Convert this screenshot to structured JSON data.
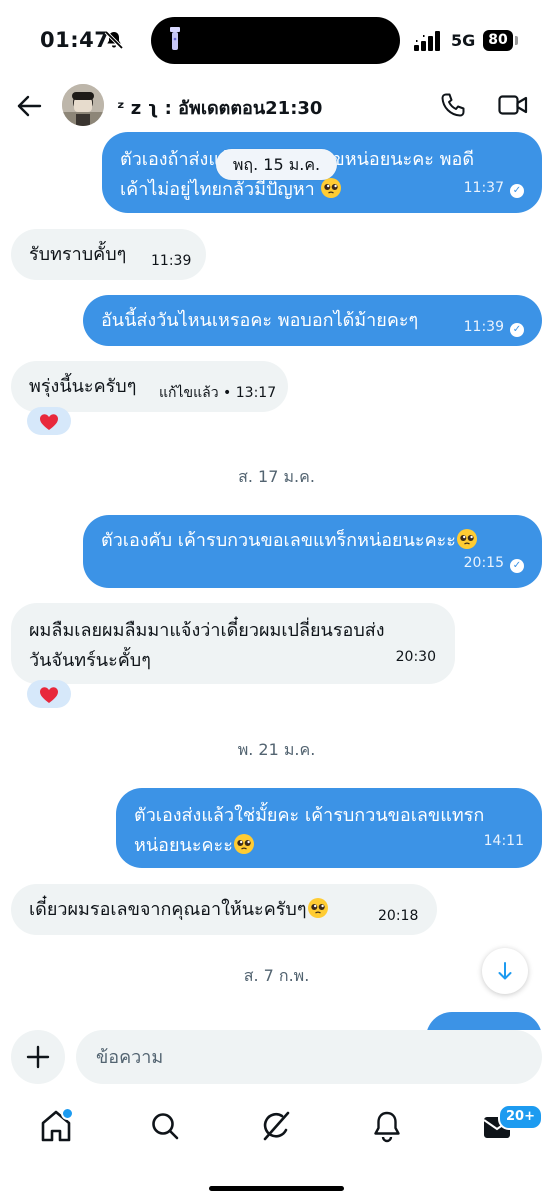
{
  "status_bar": {
    "time": "01:47",
    "network": "5G",
    "battery": "80"
  },
  "header": {
    "title": "ᶻ z ʅ : อัพเดตตอน21:30"
  },
  "floating_date": "พฤ. 15 ม.ค.",
  "messages": [
    {
      "id": "m1",
      "dir": "out",
      "lines": [
        "ตัวเองถ้าส่งแล้วรบกวนส่งเลขหน่อยนะคะ พอดี",
        "เค้าไม่อยู่ไทยกลัวมีปัญหา"
      ],
      "time": "11:37",
      "status": "read"
    },
    {
      "id": "m2",
      "dir": "in",
      "lines": [
        "รับทราบคั้บๆ"
      ],
      "time": "11:39"
    },
    {
      "id": "m3",
      "dir": "out",
      "lines": [
        "อันนี้ส่งวันไหนเหรอคะ พอบอกได้ม้ายคะๆ"
      ],
      "time": "11:39",
      "status": "read"
    },
    {
      "id": "m4",
      "dir": "in",
      "lines": [
        "พรุ่งนี้นะครับๆ"
      ],
      "edited": "แก้ไขแล้ว",
      "time": "13:17",
      "reaction": "heart"
    },
    {
      "id": "m5",
      "dir": "out",
      "lines": [
        "ตัวเองคับ เค้ารบกวนขอเลขแทร็กหน่อยนะคะะ"
      ],
      "time": "20:15",
      "status": "read"
    },
    {
      "id": "m6",
      "dir": "in",
      "lines": [
        "ผมลืมเลยผมลืมมาแจ้งว่าเดี๋ยวผมเปลี่ยนรอบส่ง",
        "วันจันทร์นะคั้บๆ"
      ],
      "time": "20:30",
      "reaction": "heart"
    },
    {
      "id": "m7",
      "dir": "out",
      "lines": [
        "ตัวเองส่งแล้วใช่มั้ยคะ เค้ารบกวนขอเลขแทรก",
        "หน่อยนะคะะ"
      ],
      "time": "14:11"
    },
    {
      "id": "m8",
      "dir": "in",
      "lines": [
        "เดี๋ยวผมรอเลขจากคุณอาให้นะครับๆ"
      ],
      "time": "20:18"
    }
  ],
  "date_separators": [
    "ส. 17 ม.ค.",
    "พ. 21 ม.ค.",
    "ส. 7 ก.พ."
  ],
  "composer": {
    "placeholder": "ข้อความ"
  },
  "tabs": [
    {
      "name": "home",
      "has_dot": true
    },
    {
      "name": "search"
    },
    {
      "name": "grok"
    },
    {
      "name": "notifications"
    },
    {
      "name": "messages",
      "badge": "20+"
    }
  ],
  "colors": {
    "outgoing_bubble": "#3c93e6",
    "incoming_bubble": "#eff3f4",
    "accent": "#1d9bf0"
  }
}
